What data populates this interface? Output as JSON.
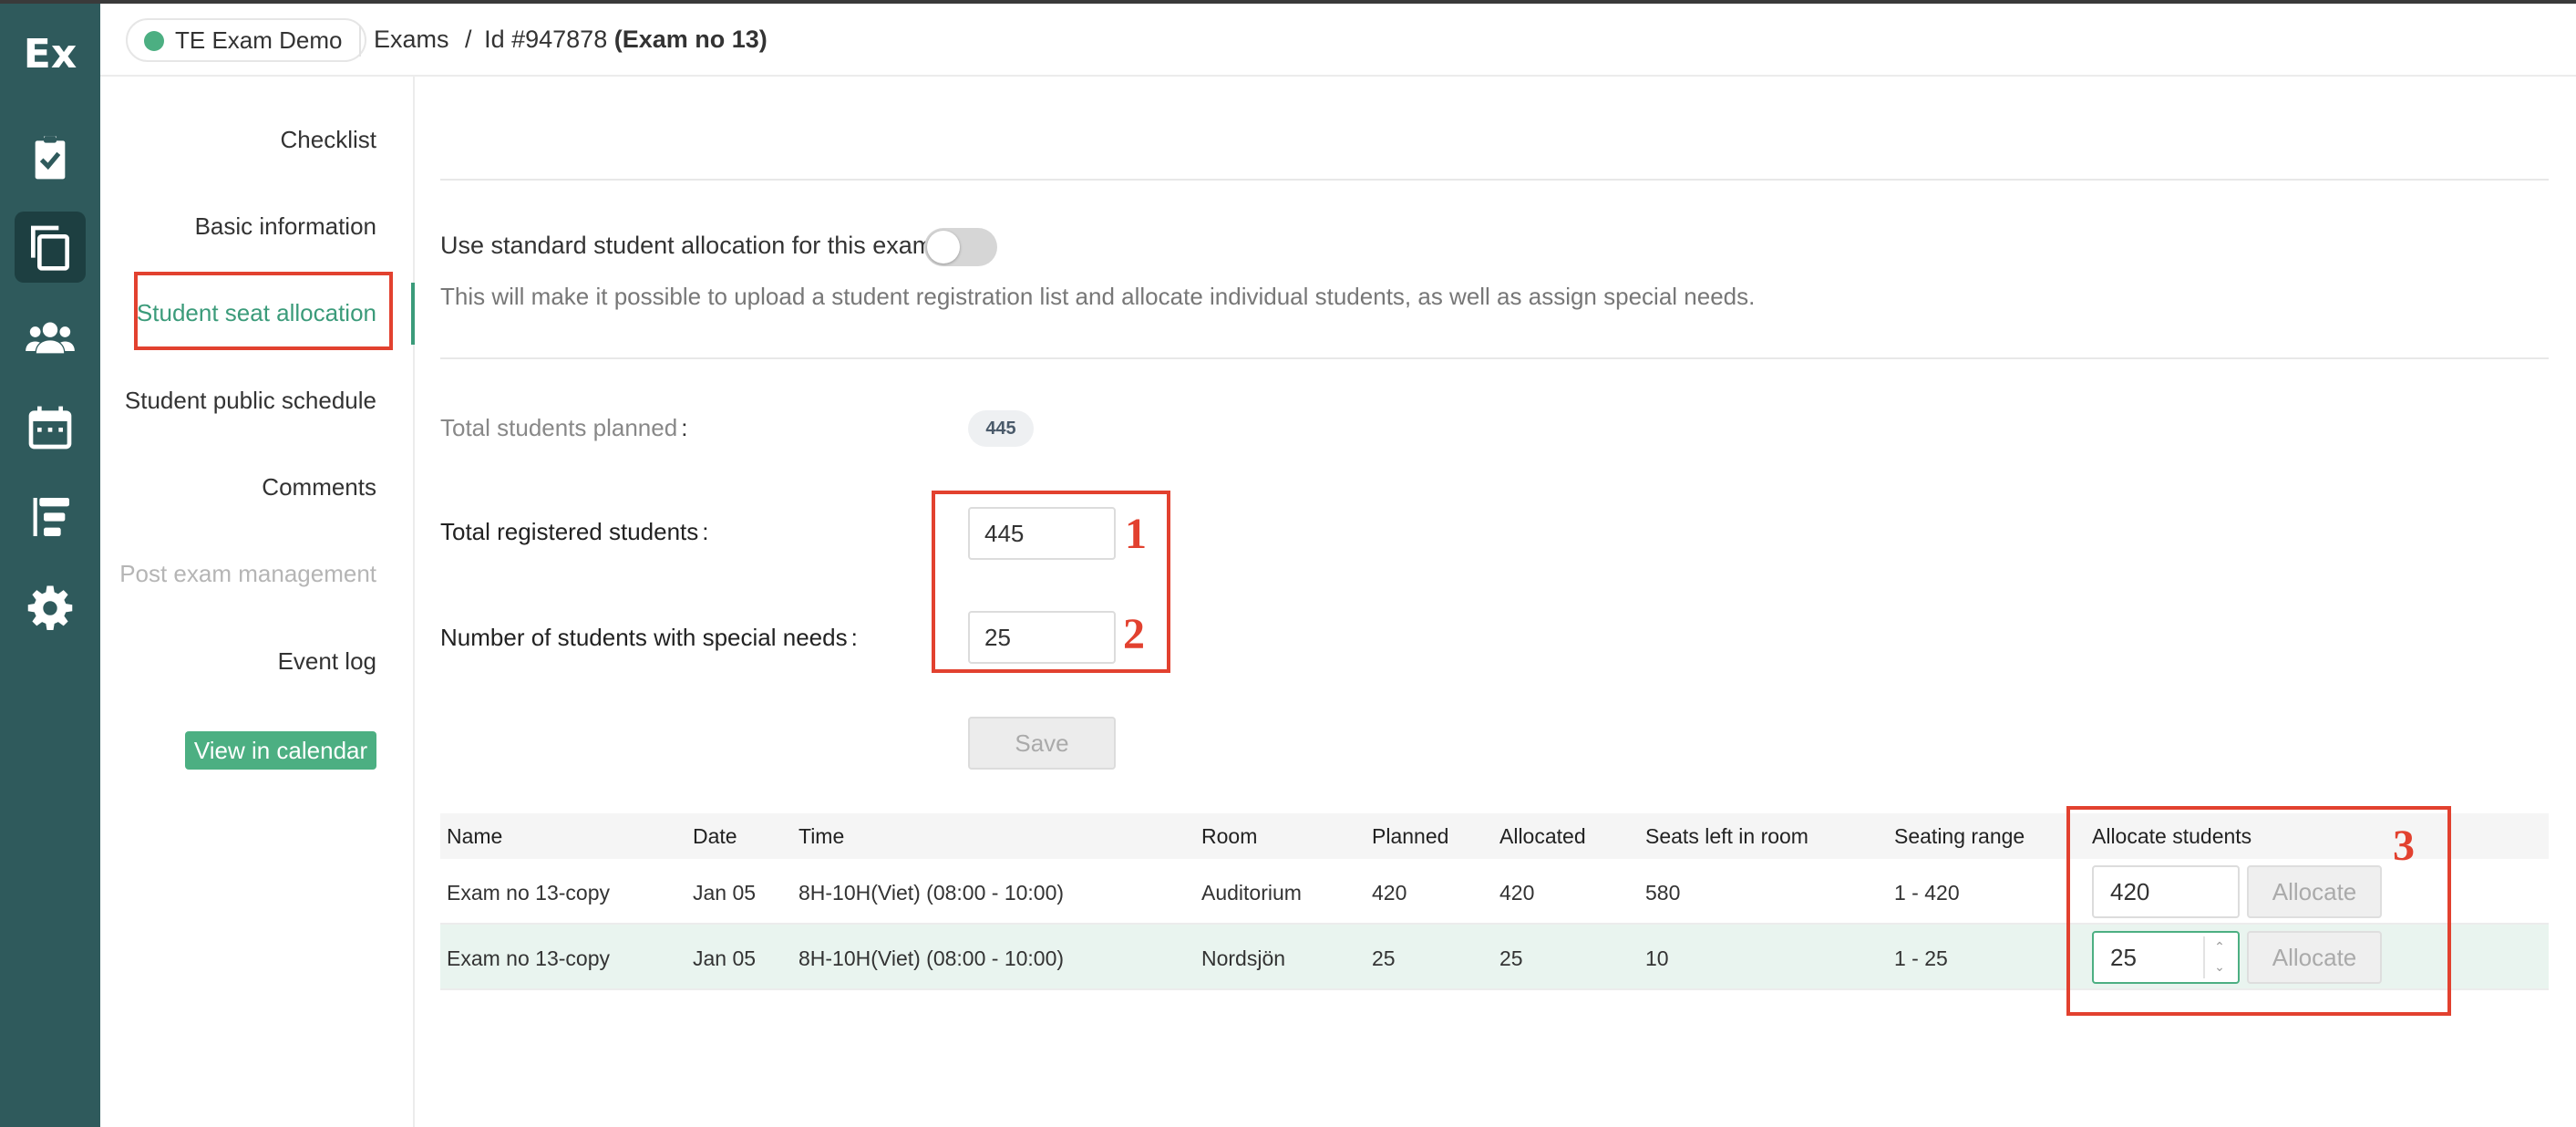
{
  "app": {
    "logo": "Ex",
    "environment": "TE Exam Demo",
    "env_color": "#4caf82",
    "accent": "#3b9b7a"
  },
  "rail_icons": [
    "clipboard-check-icon",
    "copy-icon",
    "users-icon",
    "calendar-icon",
    "hierarchy-icon",
    "gear-icon"
  ],
  "breadcrumb": {
    "root": "Exams",
    "separator": "/",
    "id_text": "Id #947878",
    "name": "(Exam no 13)"
  },
  "subnav": {
    "items": [
      {
        "label": "Checklist",
        "state": "normal"
      },
      {
        "label": "Basic information",
        "state": "normal"
      },
      {
        "label": "Student seat allocation",
        "state": "active"
      },
      {
        "label": "Student public schedule",
        "state": "normal"
      },
      {
        "label": "Comments",
        "state": "normal"
      },
      {
        "label": "Post exam management",
        "state": "disabled"
      },
      {
        "label": "Event log",
        "state": "normal"
      }
    ],
    "calendar_button": "View in calendar"
  },
  "allocation": {
    "toggle_label": "Use standard student allocation for this exam",
    "toggle_on": false,
    "description": "This will make it possible to upload a student registration list and allocate individual students, as well as assign special needs.",
    "total_planned_label": "Total students planned",
    "total_planned_value": "445",
    "colon": ":",
    "total_registered_label": "Total registered students",
    "total_registered_value": "445",
    "special_needs_label": "Number of students with special needs",
    "special_needs_value": "25",
    "save_label": "Save"
  },
  "table": {
    "headers": [
      "Name",
      "Date",
      "Time",
      "Room",
      "Planned",
      "Allocated",
      "Seats left in room",
      "Seating range",
      "Allocate students"
    ],
    "rows": [
      {
        "name": "Exam no 13-copy",
        "date": "Jan 05",
        "time": "8H-10H(Viet) (08:00 - 10:00)",
        "room": "Auditorium",
        "planned": "420",
        "allocated": "420",
        "seats_left": "580",
        "range": "1 - 420",
        "allocate_value": "420",
        "button": "Allocate"
      },
      {
        "name": "Exam no 13-copy",
        "date": "Jan 05",
        "time": "8H-10H(Viet) (08:00 - 10:00)",
        "room": "Nordsjön",
        "planned": "25",
        "allocated": "25",
        "seats_left": "10",
        "range": "1 - 25",
        "allocate_value": "25",
        "button": "Allocate"
      }
    ]
  },
  "annotations": {
    "marker_1": "1",
    "marker_2": "2",
    "marker_3": "3",
    "color": "#e2412f"
  }
}
